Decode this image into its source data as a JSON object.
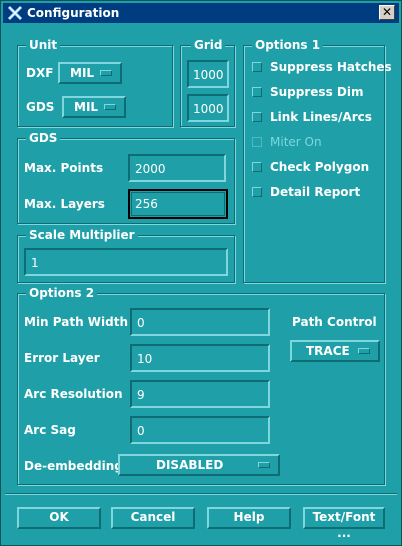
{
  "window": {
    "title": "Configuration",
    "close_glyph": "✕"
  },
  "unit": {
    "legend": "Unit",
    "dxf_label": "DXF",
    "dxf_value": "MIL",
    "gds_label": "GDS",
    "gds_value": "MIL"
  },
  "grid": {
    "legend": "Grid",
    "value1": "1000",
    "value2": "1000"
  },
  "options1": {
    "legend": "Options 1",
    "items": [
      {
        "label": "Suppress Hatches",
        "enabled": true
      },
      {
        "label": "Suppress Dim",
        "enabled": true
      },
      {
        "label": "Link Lines/Arcs",
        "enabled": true
      },
      {
        "label": "Miter On",
        "enabled": false
      },
      {
        "label": "Check Polygon",
        "enabled": true
      },
      {
        "label": "Detail Report",
        "enabled": true
      }
    ]
  },
  "gds": {
    "legend": "GDS",
    "max_points_label": "Max. Points",
    "max_points_value": "2000",
    "max_layers_label": "Max. Layers",
    "max_layers_value": "256"
  },
  "scale": {
    "legend": "Scale Multiplier",
    "value": "1"
  },
  "options2": {
    "legend": "Options 2",
    "min_path_width_label": "Min Path Width",
    "min_path_width_value": "0",
    "error_layer_label": "Error Layer",
    "error_layer_value": "10",
    "arc_resolution_label": "Arc Resolution",
    "arc_resolution_value": "9",
    "arc_sag_label": "Arc Sag",
    "arc_sag_value": "0",
    "deembedding_label": "De-embedding",
    "deembedding_value": "DISABLED",
    "path_control_label": "Path Control",
    "path_control_value": "TRACE"
  },
  "buttons": {
    "ok": "OK",
    "cancel": "Cancel",
    "help": "Help",
    "textfont": "Text/Font ..."
  }
}
